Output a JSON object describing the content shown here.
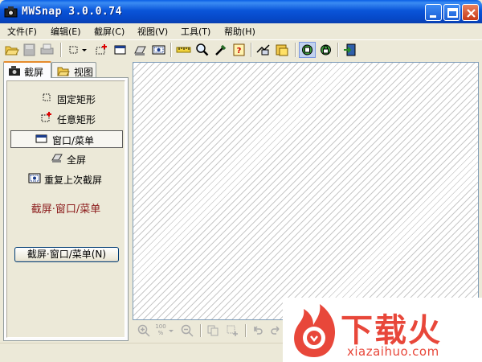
{
  "window": {
    "title": "MWSnap  3.0.0.74"
  },
  "menu": [
    {
      "label": "文件(F)"
    },
    {
      "label": "编辑(E)"
    },
    {
      "label": "截屏(C)"
    },
    {
      "label": "视图(V)"
    },
    {
      "label": "工具(T)"
    },
    {
      "label": "帮助(H)"
    }
  ],
  "toolbar_icons": [
    "open-icon",
    "save-icon",
    "print-icon",
    "fixed-rect-icon",
    "dropdown-arrow-icon",
    "any-rect-icon",
    "window-icon",
    "fullscreen-icon",
    "repeat-icon",
    "ruler-icon",
    "magnifier-icon",
    "color-picker-icon",
    "help-icon",
    "options-icon",
    "hotkeys-icon",
    "pin-icon",
    "lock-icon",
    "exit-icon"
  ],
  "tabs": [
    {
      "label": "截屏",
      "active": true
    },
    {
      "label": "视图",
      "active": false
    }
  ],
  "capture_panel": {
    "items": [
      {
        "label": "固定矩形",
        "selected": false
      },
      {
        "label": "任意矩形",
        "selected": false
      },
      {
        "label": "窗口/菜单",
        "selected": true
      },
      {
        "label": "全屏",
        "selected": false
      },
      {
        "label": "重复上次截屏",
        "selected": false
      }
    ],
    "current_mode": "截屏·窗口/菜单",
    "capture_button": "截屏·窗口/菜单(N)"
  },
  "zoombar": {
    "zoom_top": "100",
    "zoom_bottom": "%"
  },
  "watermark": {
    "title": "下载火",
    "url": "xiazaihuo.com"
  },
  "colors": {
    "titlebar": "#0a55d9",
    "mode_text": "#8b1a1a",
    "watermark": "#e8473a",
    "tab_accent": "#e68b2c"
  }
}
